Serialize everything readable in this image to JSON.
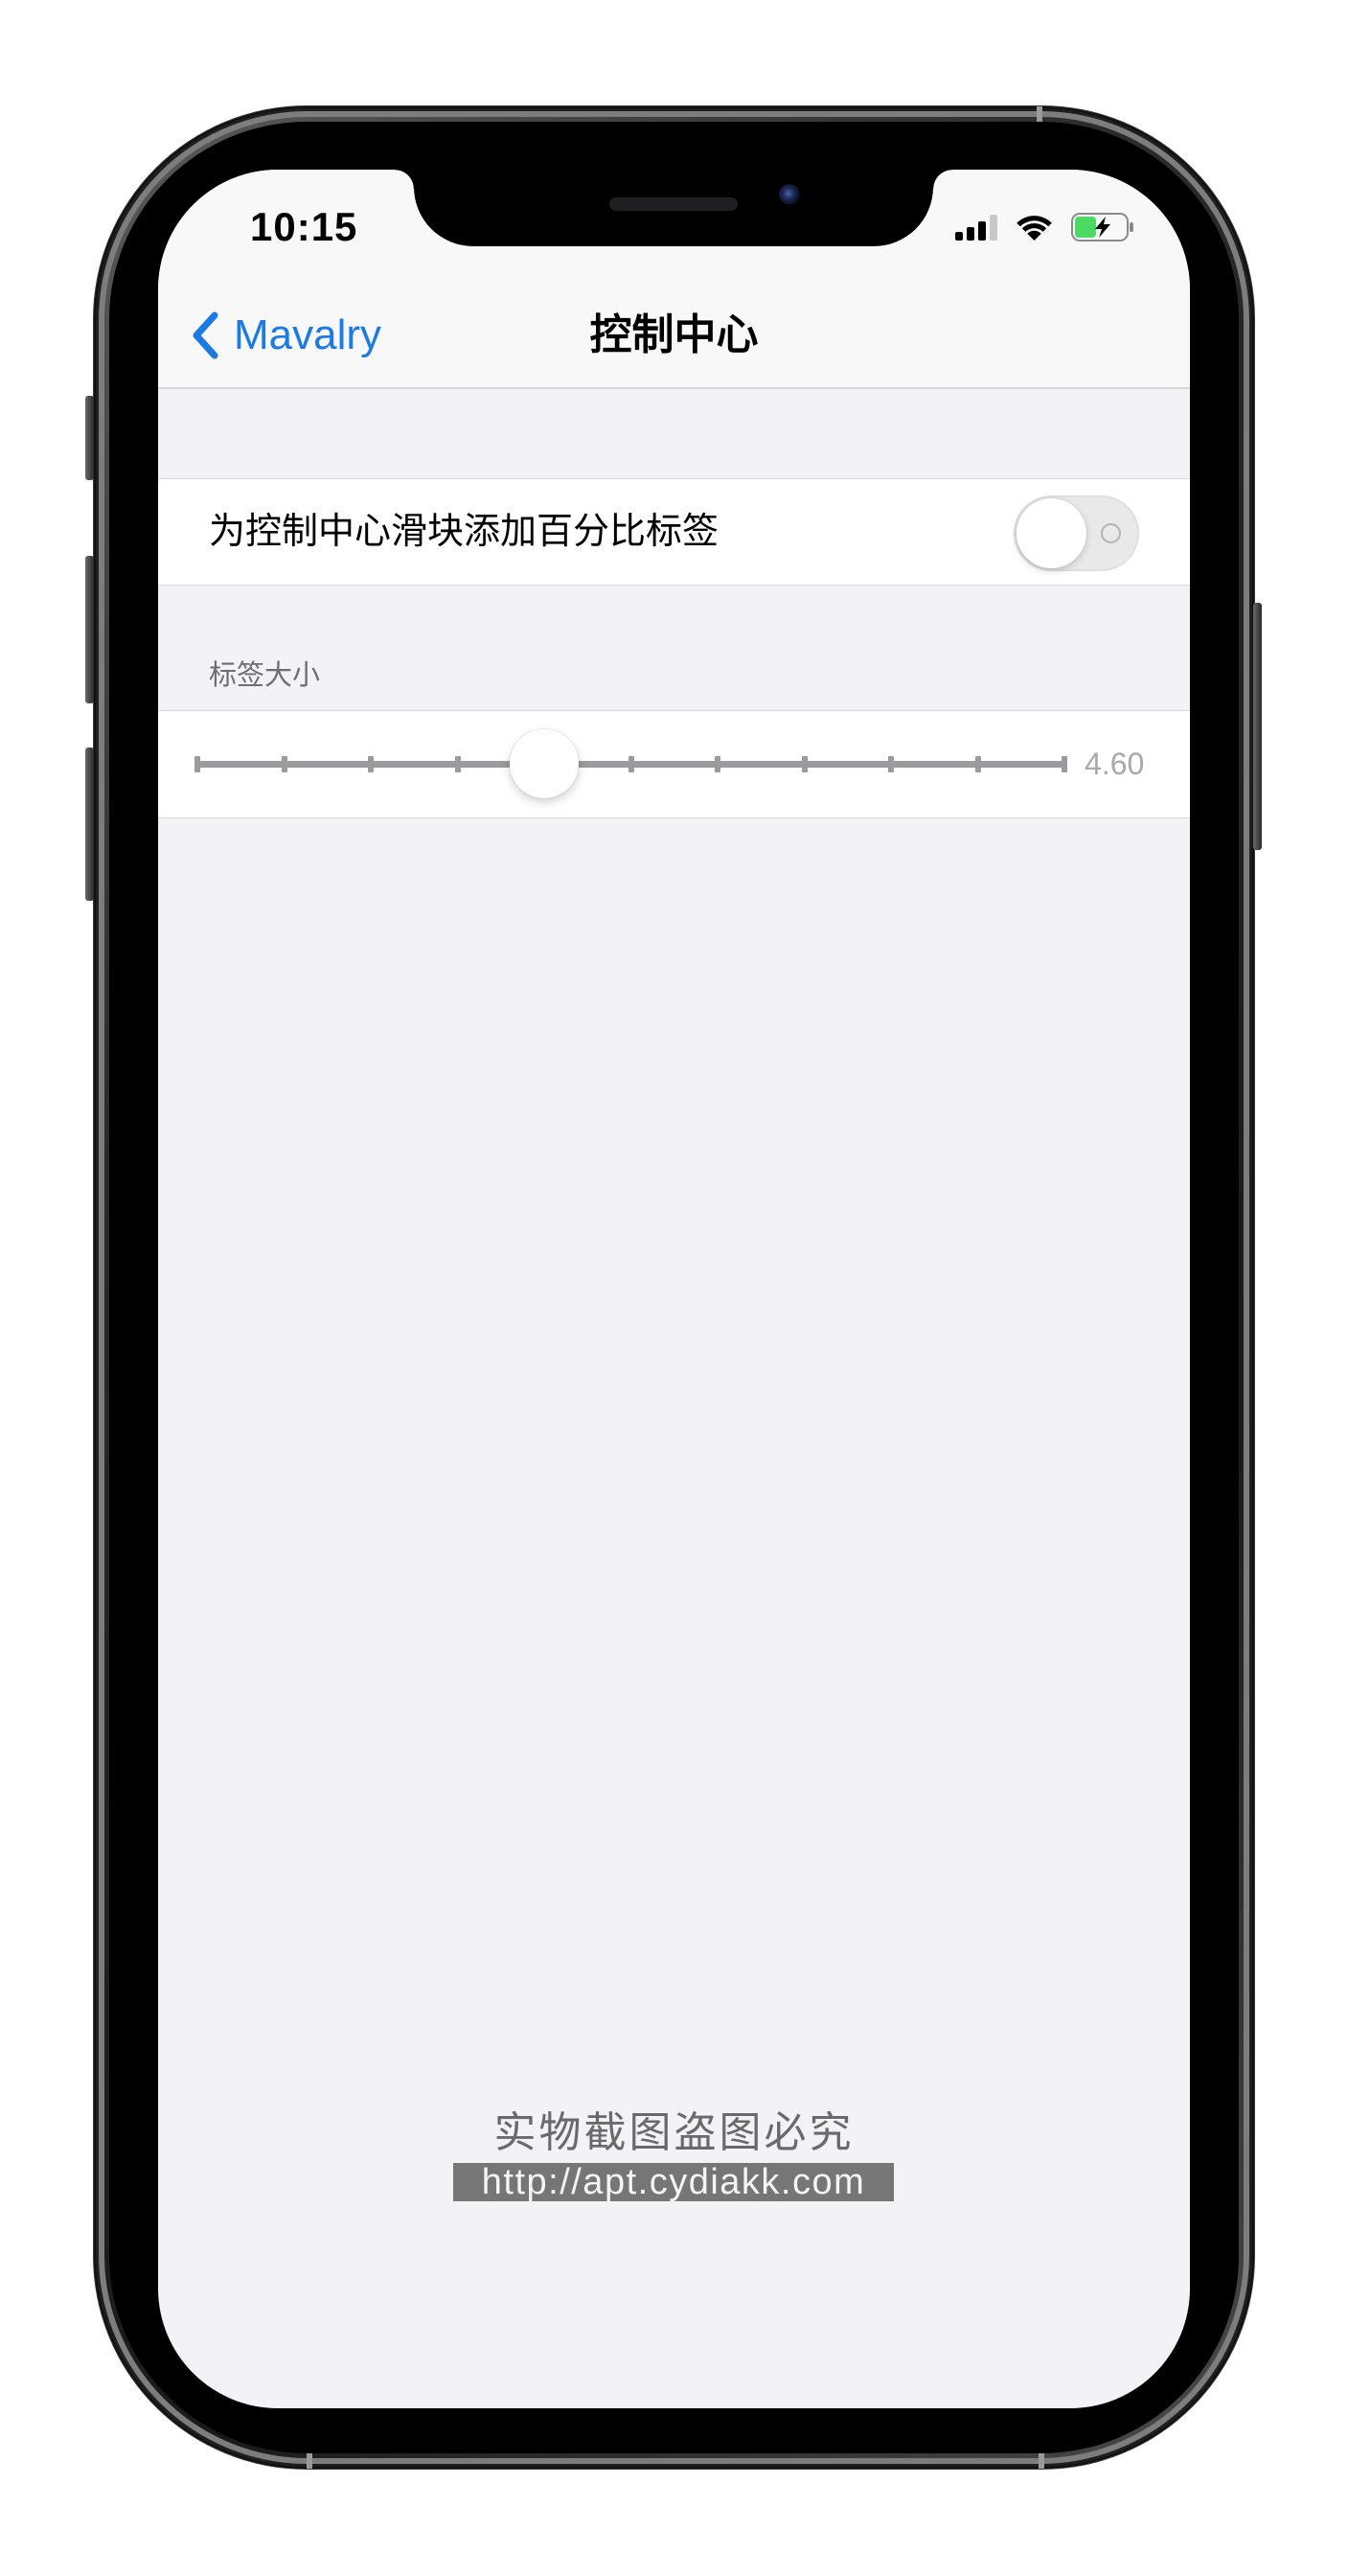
{
  "status_bar": {
    "time": "10:15",
    "icons": [
      "cellular-signal-icon",
      "wifi-icon",
      "battery-charging-icon"
    ]
  },
  "nav": {
    "back_icon": "chevron-left-icon",
    "back_label": "Mavalry",
    "title": "控制中心"
  },
  "toggle_cell": {
    "label": "为控制中心滑块添加百分比标签",
    "on": false
  },
  "slider_section": {
    "header": "标签大小",
    "value_label": "4.60",
    "level": 0.4
  },
  "watermark": {
    "line1": "实物截图盗图必究",
    "line2": "http://apt.cydiakk.com"
  },
  "colors": {
    "accent": "#1b7ae4",
    "background": "#f2f2f7",
    "battery_fill": "#4cd964",
    "track": "#9b9b9f"
  }
}
